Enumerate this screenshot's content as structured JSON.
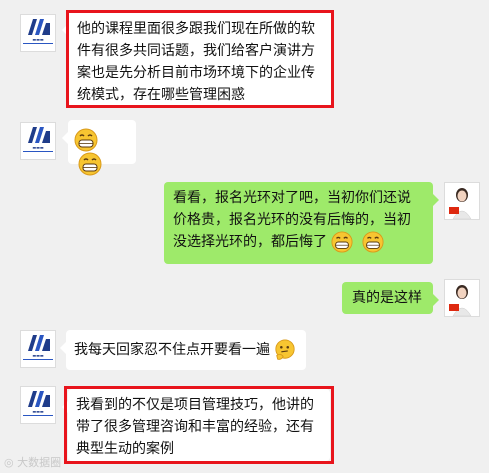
{
  "messages": [
    {
      "side": "left",
      "text": "他的课程里面很多跟我们现在所做的软件有很多共同话题，我们给客户演讲方案也是先分析目前市场环境下的企业传统模式，存在哪些管理困惑",
      "highlighted": true
    },
    {
      "side": "left",
      "emoji": [
        "grin-emoji",
        "grin-emoji"
      ]
    },
    {
      "side": "right",
      "text": "看看，报名光环对了吧，当初你们还说价格贵，报名光环的没有后悔的，当初没选择光环的，都后悔了",
      "emoji": [
        "grin-emoji",
        "grin-emoji"
      ]
    },
    {
      "side": "right",
      "text": "真的是这样"
    },
    {
      "side": "left",
      "text": "我每天回家忍不住点开要看一遍",
      "emoji": [
        "thinking-emoji"
      ]
    },
    {
      "side": "left",
      "text": "我看到的不仅是项目管理技巧，他讲的带了很多管理咨询和丰富的经验，还有典型生动的案例",
      "highlighted": true
    }
  ],
  "watermark": "大数据圈",
  "colors": {
    "self_bubble": "#9eea6a",
    "other_bubble": "#ffffff",
    "highlight": "#e8141c",
    "background": "#f0f0f0"
  }
}
